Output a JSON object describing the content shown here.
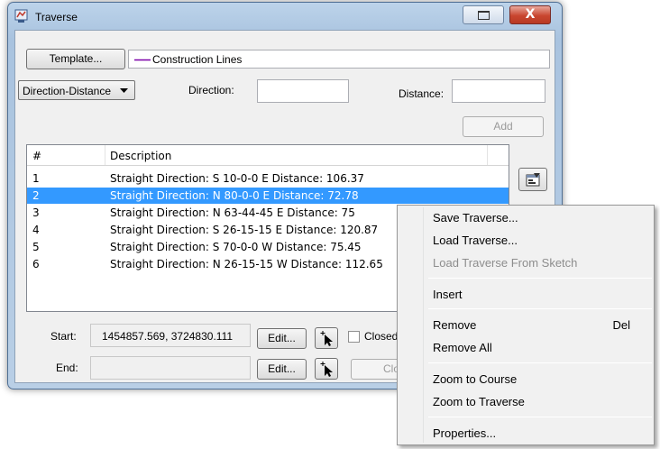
{
  "window": {
    "title": "Traverse",
    "close_glyph": "X"
  },
  "top": {
    "template_label": "Template...",
    "template_value": "Construction Lines",
    "mode_value": "Direction-Distance",
    "direction_label": "Direction:",
    "direction_value": "",
    "distance_label": "Distance:",
    "distance_value": "",
    "add_label": "Add"
  },
  "list": {
    "headers": [
      "#",
      "Description"
    ],
    "rows": [
      {
        "num": "1",
        "desc": "Straight  Direction: S 10-0-0 E  Distance: 106.37"
      },
      {
        "num": "2",
        "desc": "Straight  Direction: N 80-0-0 E  Distance: 72.78"
      },
      {
        "num": "3",
        "desc": "Straight  Direction: N 63-44-45 E  Distance: 75"
      },
      {
        "num": "4",
        "desc": "Straight  Direction: S 26-15-15 E  Distance: 120.87"
      },
      {
        "num": "5",
        "desc": "Straight  Direction: S 70-0-0 W  Distance: 75.45"
      },
      {
        "num": "6",
        "desc": "Straight  Direction: N 26-15-15 W  Distance: 112.65"
      }
    ],
    "selected_index": 1
  },
  "bottom": {
    "start_label": "Start:",
    "start_value": "1454857.569,  3724830.111",
    "end_label": "End:",
    "end_value": "",
    "edit_label": "Edit...",
    "closed_label": "Closed",
    "close_label": "Clos"
  },
  "menu": {
    "items": [
      {
        "label": "Save Traverse...",
        "shortcut": "",
        "enabled": true
      },
      {
        "label": "Load Traverse...",
        "shortcut": "",
        "enabled": true
      },
      {
        "label": "Load Traverse From Sketch",
        "shortcut": "",
        "enabled": false
      },
      {
        "label": "Insert",
        "shortcut": "",
        "enabled": true
      },
      {
        "label": "Remove",
        "shortcut": "Del",
        "enabled": true
      },
      {
        "label": "Remove All",
        "shortcut": "",
        "enabled": true
      },
      {
        "label": "Zoom to Course",
        "shortcut": "",
        "enabled": true
      },
      {
        "label": "Zoom to Traverse",
        "shortcut": "",
        "enabled": true
      },
      {
        "label": "Properties...",
        "shortcut": "",
        "enabled": true
      }
    ]
  },
  "colors": {
    "selection": "#3399ff",
    "construction_line": "#7a00a8"
  },
  "icons": [
    "traverse-app-icon",
    "restore-icon",
    "close-icon",
    "dropdown-arrow-icon",
    "properties-icon",
    "snap-cursor-icon"
  ]
}
